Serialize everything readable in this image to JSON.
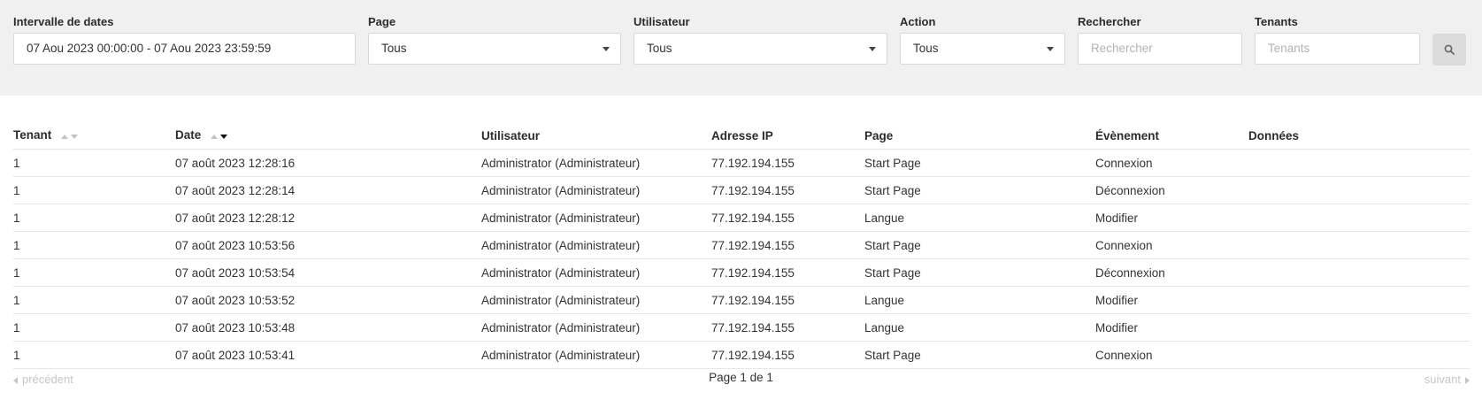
{
  "filters": {
    "date_range": {
      "label": "Intervalle de dates",
      "value": "07 Aou 2023 00:00:00 - 07 Aou 2023 23:59:59"
    },
    "page": {
      "label": "Page",
      "value": "Tous"
    },
    "user": {
      "label": "Utilisateur",
      "value": "Tous"
    },
    "action": {
      "label": "Action",
      "value": "Tous"
    },
    "search": {
      "label": "Rechercher",
      "placeholder": "Rechercher"
    },
    "tenants": {
      "label": "Tenants",
      "placeholder": "Tenants"
    },
    "search_button_icon": "search-icon"
  },
  "table": {
    "columns": [
      "Tenant",
      "Date",
      "Utilisateur",
      "Adresse IP",
      "Page",
      "Évènement",
      "Données"
    ],
    "sort": {
      "column": "Date",
      "direction": "descending"
    },
    "rows": [
      [
        "1",
        "07 août 2023 12:28:16",
        "Administrator (Administrateur)",
        "77.192.194.155",
        "Start Page",
        "Connexion",
        ""
      ],
      [
        "1",
        "07 août 2023 12:28:14",
        "Administrator (Administrateur)",
        "77.192.194.155",
        "Start Page",
        "Déconnexion",
        ""
      ],
      [
        "1",
        "07 août 2023 12:28:12",
        "Administrator (Administrateur)",
        "77.192.194.155",
        "Langue",
        "Modifier",
        ""
      ],
      [
        "1",
        "07 août 2023 10:53:56",
        "Administrator (Administrateur)",
        "77.192.194.155",
        "Start Page",
        "Connexion",
        ""
      ],
      [
        "1",
        "07 août 2023 10:53:54",
        "Administrator (Administrateur)",
        "77.192.194.155",
        "Start Page",
        "Déconnexion",
        ""
      ],
      [
        "1",
        "07 août 2023 10:53:52",
        "Administrator (Administrateur)",
        "77.192.194.155",
        "Langue",
        "Modifier",
        ""
      ],
      [
        "1",
        "07 août 2023 10:53:48",
        "Administrator (Administrateur)",
        "77.192.194.155",
        "Langue",
        "Modifier",
        ""
      ],
      [
        "1",
        "07 août 2023 10:53:41",
        "Administrator (Administrateur)",
        "77.192.194.155",
        "Start Page",
        "Connexion",
        ""
      ]
    ]
  },
  "pagination": {
    "prev_label": "précédent",
    "next_label": "suivant",
    "info": "Page 1 de 1"
  },
  "colors": {
    "filter_bar_bg": "#f0f0f0",
    "search_button_bg": "#dcdcdc",
    "disabled_text": "#c6c6c6"
  }
}
